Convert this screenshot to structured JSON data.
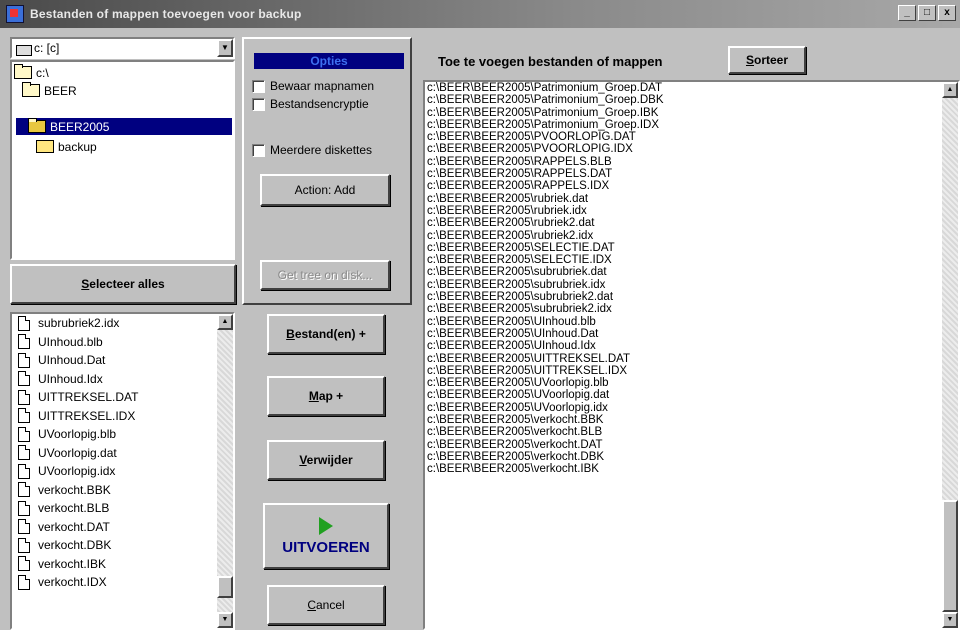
{
  "window": {
    "title": "Bestanden of mappen toevoegen voor backup",
    "controls": {
      "minimize": "_",
      "maximize": "□",
      "close": "x"
    }
  },
  "left": {
    "drive": "c: [c]",
    "tree": [
      {
        "label": "c:\\",
        "state": "open"
      },
      {
        "label": "BEER",
        "state": "open"
      },
      {
        "label": "BEER2005",
        "state": "open",
        "selected": true
      },
      {
        "label": "backup",
        "state": "closed"
      }
    ],
    "select_all_label": "Selecteer alles",
    "files": [
      "subrubriek2.idx",
      "UInhoud.blb",
      "UInhoud.Dat",
      "UInhoud.Idx",
      "UITTREKSEL.DAT",
      "UITTREKSEL.IDX",
      "UVoorlopig.blb",
      "UVoorlopig.dat",
      "UVoorlopig.idx",
      "verkocht.BBK",
      "verkocht.BLB",
      "verkocht.DAT",
      "verkocht.DBK",
      "verkocht.IBK",
      "verkocht.IDX"
    ]
  },
  "options": {
    "header": "Opties",
    "keep_folder_names": "Bewaar mapnamen",
    "file_encryption": "Bestandsencryptie",
    "multiple_disks": "Meerdere diskettes",
    "action_button": "Action: Add",
    "get_tree_button": "Get tree on disk..."
  },
  "actions": {
    "add_files": "Bestand(en) +",
    "add_folder": "Map +",
    "remove": "Verwijder",
    "run": "UITVOEREN",
    "cancel": "Cancel"
  },
  "right": {
    "header": "Toe te voegen bestanden of mappen",
    "sort_label": "Sorteer",
    "paths": [
      "c:\\BEER\\BEER2005\\Patrimonium_Groep.DAT",
      "c:\\BEER\\BEER2005\\Patrimonium_Groep.DBK",
      "c:\\BEER\\BEER2005\\Patrimonium_Groep.IBK",
      "c:\\BEER\\BEER2005\\Patrimonium_Groep.IDX",
      "c:\\BEER\\BEER2005\\PVOORLOPIG.DAT",
      "c:\\BEER\\BEER2005\\PVOORLOPIG.IDX",
      "c:\\BEER\\BEER2005\\RAPPELS.BLB",
      "c:\\BEER\\BEER2005\\RAPPELS.DAT",
      "c:\\BEER\\BEER2005\\RAPPELS.IDX",
      "c:\\BEER\\BEER2005\\rubriek.dat",
      "c:\\BEER\\BEER2005\\rubriek.idx",
      "c:\\BEER\\BEER2005\\rubriek2.dat",
      "c:\\BEER\\BEER2005\\rubriek2.idx",
      "c:\\BEER\\BEER2005\\SELECTIE.DAT",
      "c:\\BEER\\BEER2005\\SELECTIE.IDX",
      "c:\\BEER\\BEER2005\\subrubriek.dat",
      "c:\\BEER\\BEER2005\\subrubriek.idx",
      "c:\\BEER\\BEER2005\\subrubriek2.dat",
      "c:\\BEER\\BEER2005\\subrubriek2.idx",
      "c:\\BEER\\BEER2005\\UInhoud.blb",
      "c:\\BEER\\BEER2005\\UInhoud.Dat",
      "c:\\BEER\\BEER2005\\UInhoud.Idx",
      "c:\\BEER\\BEER2005\\UITTREKSEL.DAT",
      "c:\\BEER\\BEER2005\\UITTREKSEL.IDX",
      "c:\\BEER\\BEER2005\\UVoorlopig.blb",
      "c:\\BEER\\BEER2005\\UVoorlopig.dat",
      "c:\\BEER\\BEER2005\\UVoorlopig.idx",
      "c:\\BEER\\BEER2005\\verkocht.BBK",
      "c:\\BEER\\BEER2005\\verkocht.BLB",
      "c:\\BEER\\BEER2005\\verkocht.DAT",
      "c:\\BEER\\BEER2005\\verkocht.DBK",
      "c:\\BEER\\BEER2005\\verkocht.IBK"
    ]
  },
  "colors": {
    "selection": "#000080",
    "run_icon": "#20a020",
    "face": "#c0c0c0"
  }
}
